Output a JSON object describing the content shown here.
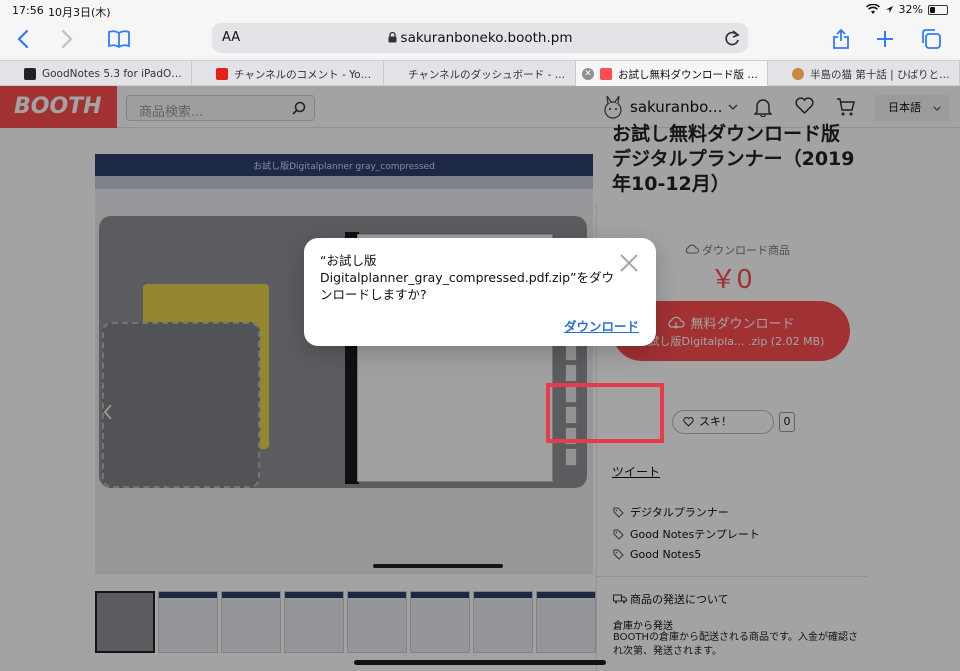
{
  "status_bar": {
    "time": "17:56",
    "date": "10月3日(木)",
    "battery": "32%",
    "battery_level": 0.32
  },
  "toolbar": {
    "text_size_label": "AA",
    "url": "sakuranboneko.booth.pm"
  },
  "tabs": [
    {
      "label": "GoodNotes 5.3 for iPadOS...",
      "favicon_color": "#222222"
    },
    {
      "label": "チャンネルのコメント - YouTu...",
      "favicon_color": "#e62117"
    },
    {
      "label": "チャンネルのダッシュボード - YouTub...",
      "favicon_color": ""
    },
    {
      "label": "お試し無料ダウンロード版 デ...",
      "favicon_color": "#fc4d50",
      "active": true
    },
    {
      "label": "半島の猫 第十話 | ひばりとおっ...",
      "favicon_color": "#c9883f"
    }
  ],
  "booth": {
    "logo": "BOOTH",
    "search_placeholder": "商品検索...",
    "username": "sakuranbo...",
    "language": "日本語",
    "product_title": "お試し無料ダウンロード版　デジタルプランナー（2019年10-12月）",
    "screenshot_title": "お試し版Digitalplanner gray_compressed",
    "planner_year": "2019",
    "download_type": "ダウンロード商品",
    "price": "￥0",
    "download_button": "無料ダウンロード",
    "download_file": "お試し版Digitalpla... .zip (2.02 MB)",
    "like_label": "スキ！",
    "like_count": "0",
    "tweet": "ツイート",
    "tags": [
      "デジタルプランナー",
      "Good Notesテンプレート",
      "Good Notes5"
    ],
    "shipping_heading": "商品の発送について",
    "shipping_sub": "倉庫から発送",
    "shipping_text": "BOOTHの倉庫から配送される商品です。入金が確認され次第、発送されます。"
  },
  "dialog": {
    "message": "“お試し版Digitalplanner_gray_compressed.pdf.zip”をダウンロードしますか?",
    "download_label": "ダウンロード"
  },
  "colors": {
    "brand": "#fc4d50",
    "link": "#2a6fd8",
    "highlight": "#e83a4c"
  }
}
